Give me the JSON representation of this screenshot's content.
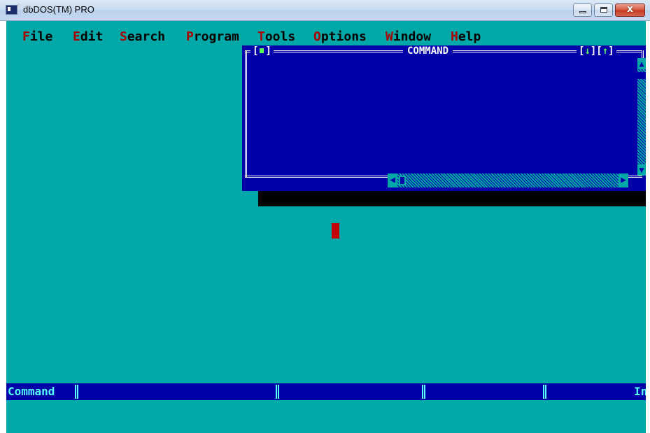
{
  "window": {
    "title": "dbDOS(TM) PRO",
    "close_glyph": "x"
  },
  "menu": [
    {
      "hotkey": "F",
      "rest": "ile"
    },
    {
      "hotkey": "E",
      "rest": "dit"
    },
    {
      "hotkey": "S",
      "rest": "earch"
    },
    {
      "hotkey": "P",
      "rest": "rogram"
    },
    {
      "hotkey": "T",
      "rest": "ools"
    },
    {
      "hotkey": "O",
      "rest": "ptions"
    },
    {
      "hotkey": "W",
      "rest": "indow"
    },
    {
      "hotkey": "H",
      "rest": "elp"
    }
  ],
  "command_window": {
    "title": "COMMAND",
    "close_box_left": "[",
    "close_box_right": "]",
    "zoom_left": "[",
    "zoom_down": "↓",
    "zoom_mid": "][",
    "zoom_up": "↑",
    "zoom_right": "]"
  },
  "statusbar": {
    "label": "Command",
    "mode": "Ins"
  },
  "colors": {
    "desktop": "#00a8a8",
    "window_bg": "#0000a8",
    "hotkey": "#a80000",
    "status_text": "#55ffff"
  }
}
